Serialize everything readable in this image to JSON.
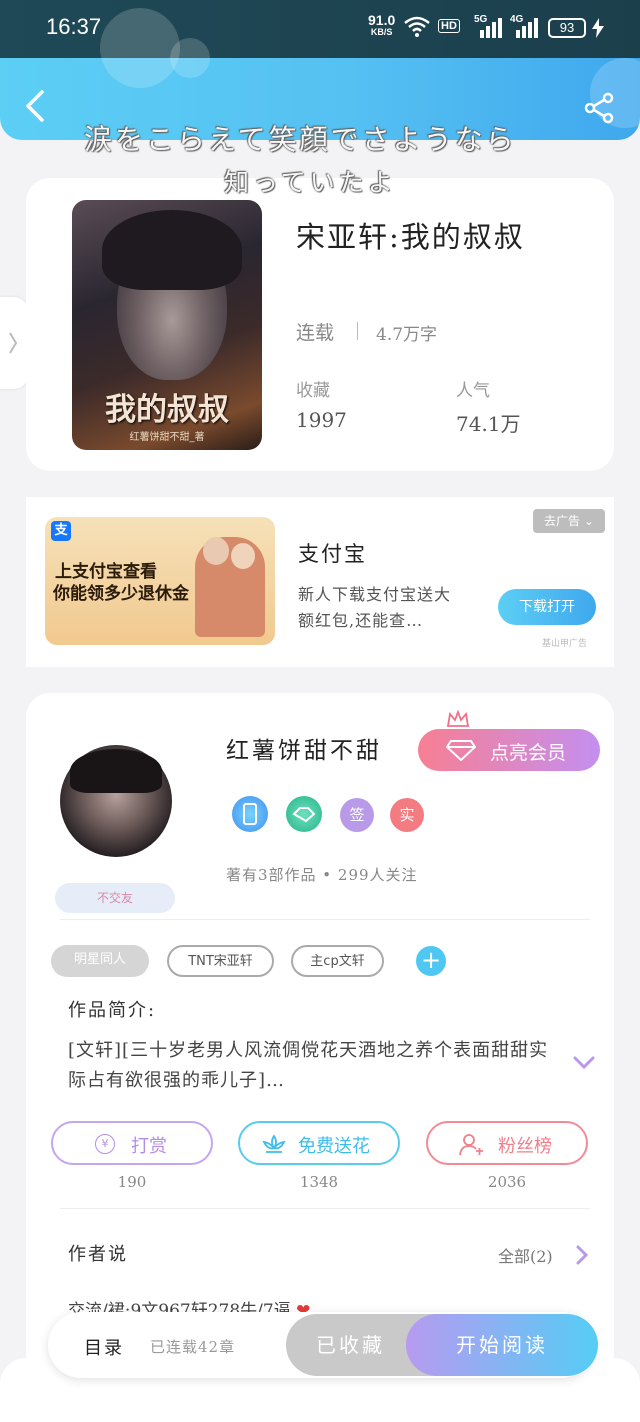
{
  "status": {
    "time": "16:37",
    "speed_value": "91.0",
    "speed_unit": "KB/S",
    "hd": "HD",
    "net1": "5G",
    "net2": "4G",
    "battery": "93"
  },
  "lyrics": {
    "line1": "涙をこらえて笑顔でさようなら",
    "line2": "知っていたよ"
  },
  "book": {
    "title": "宋亚轩:我的叔叔",
    "status": "连载",
    "words": "4.7万字",
    "fav_label": "收藏",
    "fav_value": "1997",
    "pop_label": "人气",
    "pop_value": "74.1万",
    "cover_title": "我的叔叔",
    "cover_author": "红薯饼甜不甜_著"
  },
  "ad": {
    "close_label": "去广告",
    "app_name": "支付宝",
    "desc": "新人下载支付宝送大额红包,还能查…",
    "button": "下载打开",
    "source": "基山甲广告",
    "img_line1": "上支付宝查看",
    "img_line2": "你能领多少退休金",
    "img_logo": "支"
  },
  "author": {
    "name": "红薯饼甜不甜",
    "vip_button": "点亮会员",
    "badge1": "签",
    "badge2": "实",
    "stats": "著有3部作品 • 299人关注",
    "tag_label": "不交友"
  },
  "tags": [
    "明星同人",
    "TNT宋亚轩",
    "主cp文轩"
  ],
  "intro": {
    "label": "作品简介:",
    "text": "[文轩][三十岁老男人风流倜傥花天酒地之养个表面甜甜实际占有欲很强的乖儿子]…"
  },
  "actions": [
    {
      "label": "打赏",
      "count": "190"
    },
    {
      "label": "免费送花",
      "count": "1348"
    },
    {
      "label": "粉丝榜",
      "count": "2036"
    }
  ],
  "author_say": {
    "label": "作者说",
    "all": "全部(2)",
    "preview": "交流/裙:9文967轩278牛/7逼"
  },
  "bottom": {
    "toc": "目录",
    "chapters": "已连载42章",
    "collected": "已收藏",
    "read": "开始阅读"
  },
  "colors": {
    "header_accent": "#55c0f2",
    "vip_gradient_start": "#f77f93",
    "vip_gradient_end": "#c48ff0",
    "read_button_start": "#b79af0",
    "read_button_end": "#55cdf5",
    "download_button": "#4fbcf3"
  }
}
